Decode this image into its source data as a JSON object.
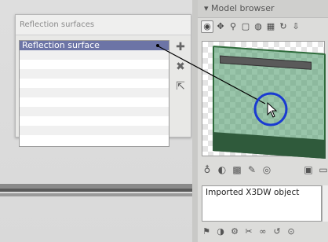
{
  "left_panel": {
    "title": "Reflection surfaces",
    "items": [
      "Reflection surface",
      "",
      "",
      "",
      "",
      "",
      "",
      "",
      "",
      ""
    ]
  },
  "right_panel": {
    "title": "Model browser",
    "description": "Imported X3DW object"
  },
  "colors": {
    "selection": "#6c74a6",
    "plane": "#3f8f5a",
    "cursor_ring": "#1a3bd1"
  }
}
